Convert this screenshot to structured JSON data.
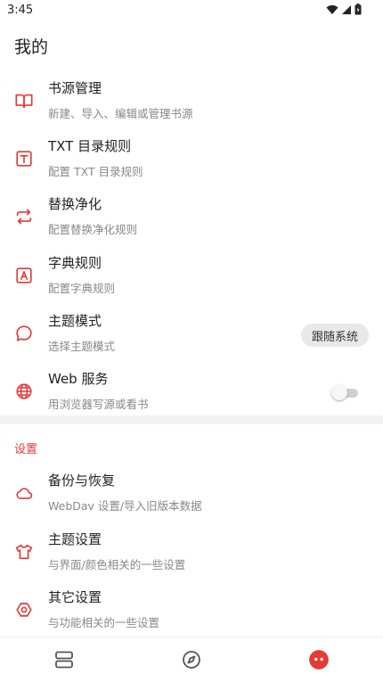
{
  "status_bar": {
    "time": "3:45",
    "icons": [
      "wifi-icon",
      "cell-signal-icon",
      "battery-icon"
    ]
  },
  "page_title": "我的",
  "accent_color": "#e53935",
  "main_items": [
    {
      "icon": "book-icon",
      "title": "书源管理",
      "subtitle": "新建、导入、编辑或管理书源"
    },
    {
      "icon": "txt-icon",
      "title": "TXT 目录规则",
      "subtitle": "配置 TXT 目录规则"
    },
    {
      "icon": "swap-icon",
      "title": "替换净化",
      "subtitle": "配置替换净化规则"
    },
    {
      "icon": "dictionary-icon",
      "title": "字典规则",
      "subtitle": "配置字典规则"
    },
    {
      "icon": "theme-bubble-icon",
      "title": "主题模式",
      "subtitle": "选择主题模式",
      "value": "跟随系统"
    },
    {
      "icon": "globe-icon",
      "title": "Web 服务",
      "subtitle": "用浏览器写源或看书",
      "toggle_on": false
    }
  ],
  "settings_section": {
    "header": "设置",
    "items": [
      {
        "icon": "cloud-icon",
        "title": "备份与恢复",
        "subtitle": "WebDav 设置/导入旧版本数据"
      },
      {
        "icon": "shirt-icon",
        "title": "主题设置",
        "subtitle": "与界面/颜色相关的一些设置"
      },
      {
        "icon": "gear-icon",
        "title": "其它设置",
        "subtitle": "与功能相关的一些设置"
      }
    ]
  },
  "bottom_nav": {
    "items": [
      "bookshelf-icon",
      "explore-icon",
      "profile-icon"
    ],
    "active": "profile-icon"
  }
}
